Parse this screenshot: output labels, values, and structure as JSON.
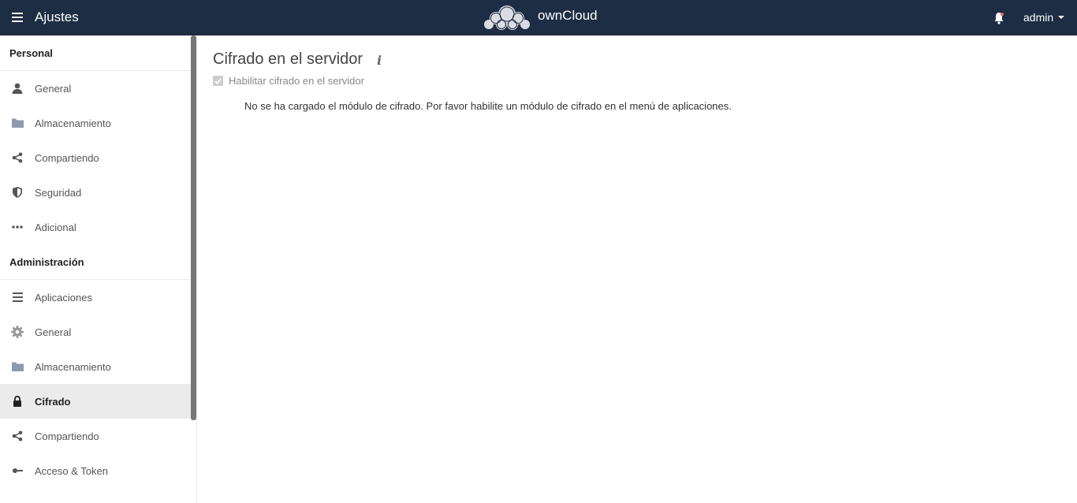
{
  "header": {
    "app_title": "Ajustes",
    "logo_text": "ownCloud",
    "user_name": "admin",
    "colors": {
      "bar": "#1d2d44",
      "text": "#ffffff"
    }
  },
  "sidebar": {
    "personal_title": "Personal",
    "personal_items": [
      {
        "label": "General",
        "icon": "user-icon"
      },
      {
        "label": "Almacenamiento",
        "icon": "folder-icon"
      },
      {
        "label": "Compartiendo",
        "icon": "share-icon"
      },
      {
        "label": "Seguridad",
        "icon": "shield-icon"
      },
      {
        "label": "Adicional",
        "icon": "more-icon"
      }
    ],
    "admin_title": "Administración",
    "admin_items": [
      {
        "label": "Aplicaciones",
        "icon": "list-icon"
      },
      {
        "label": "General",
        "icon": "gear-icon"
      },
      {
        "label": "Almacenamiento",
        "icon": "folder-icon"
      },
      {
        "label": "Cifrado",
        "icon": "lock-icon",
        "active": true
      },
      {
        "label": "Compartiendo",
        "icon": "share-icon"
      },
      {
        "label": "Acceso & Token",
        "icon": "key-icon"
      }
    ]
  },
  "main": {
    "title": "Cifrado en el servidor",
    "info_symbol": "i",
    "checkbox_label": "Habilitar cifrado en el servidor",
    "notice": "No se ha cargado el módulo de cifrado. Por favor habilite un módulo de cifrado en el menú de aplicaciones."
  }
}
